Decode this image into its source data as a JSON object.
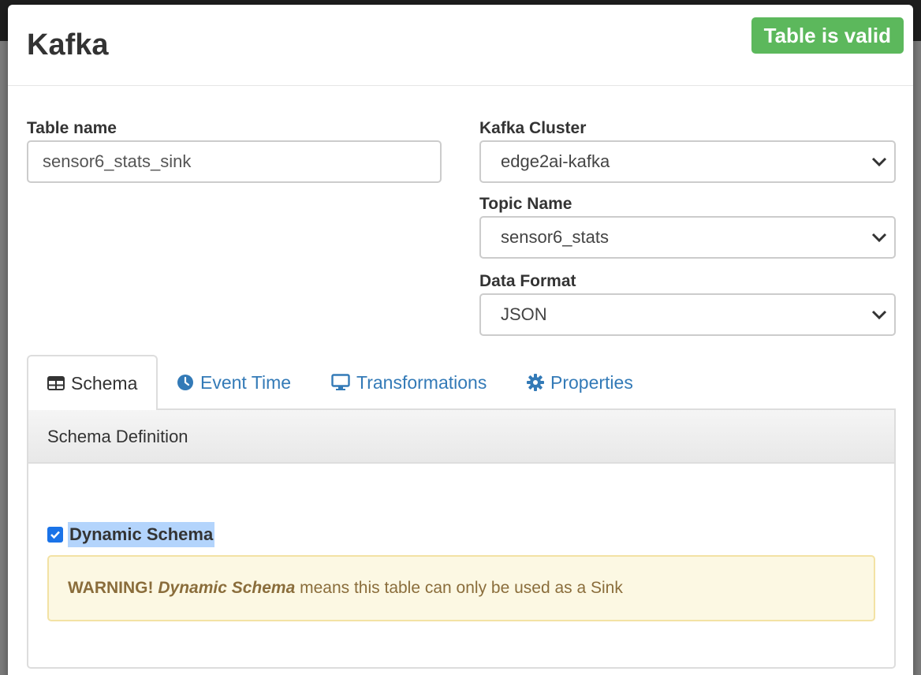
{
  "modal": {
    "title": "Kafka",
    "status_badge": "Table is valid"
  },
  "form": {
    "table_name_label": "Table name",
    "table_name_value": "sensor6_stats_sink",
    "kafka_cluster_label": "Kafka Cluster",
    "kafka_cluster_value": "edge2ai-kafka",
    "topic_name_label": "Topic Name",
    "topic_name_value": "sensor6_stats",
    "data_format_label": "Data Format",
    "data_format_value": "JSON"
  },
  "tabs": [
    {
      "label": "Schema",
      "icon": "table-icon",
      "active": true
    },
    {
      "label": "Event Time",
      "icon": "clock-icon",
      "active": false
    },
    {
      "label": "Transformations",
      "icon": "monitor-icon",
      "active": false
    },
    {
      "label": "Properties",
      "icon": "gear-icon",
      "active": false
    }
  ],
  "schema_panel": {
    "heading": "Schema Definition",
    "dynamic_schema_label": "Dynamic Schema",
    "dynamic_schema_checked": true,
    "warning_prefix": "WARNING!",
    "warning_emphasis": "Dynamic Schema",
    "warning_text": " means this table can only be used as a Sink"
  },
  "colors": {
    "success": "#5cb85c",
    "link": "#337ab7",
    "warning_bg": "#fcf8e3",
    "warning_text": "#8a6d3b"
  }
}
